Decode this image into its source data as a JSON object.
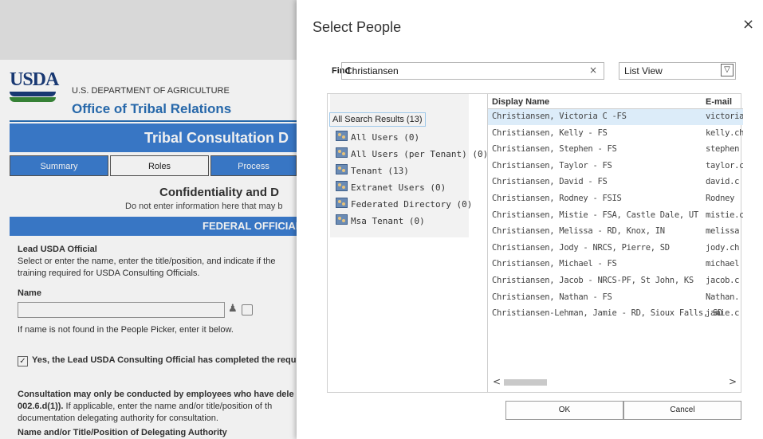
{
  "background": {
    "logo_text": "USDA",
    "department": "U.S. DEPARTMENT OF AGRICULTURE",
    "office": "Office of Tribal Relations",
    "banner": "Tribal Consultation D",
    "tabs": [
      "Summary",
      "Roles",
      "Process"
    ],
    "confidentiality_title": "Confidentiality and D",
    "confidentiality_sub": "Do not enter information here that may b",
    "federal_header": "FEDERAL OFFICIAL(",
    "lead_title": "Lead USDA Official",
    "lead_desc1": "Select or enter the name, enter the title/position, and indicate if the",
    "lead_desc2": "training required for USDA Consulting Officials.",
    "name_label": "Name",
    "not_found": "If name is not found in the People Picker, enter it below.",
    "checkbox_label": "Yes, the Lead USDA Consulting Official has completed the requ",
    "consult_line1": "Consultation may only be conducted by employees who have dele",
    "consult_line2a": "002.6.d(1)).",
    "consult_line2b": " If applicable, enter the name and/or title/position of th",
    "consult_line3": "documentation delegating authority for consultation.",
    "delegating_label": "Name and/or Title/Position of Delegating Authority"
  },
  "dialog": {
    "title": "Select People",
    "close": "×",
    "find_label": "Find",
    "find_value": "Christiansen",
    "find_clear": "×",
    "view_value": "List View",
    "view_arrow": "▽",
    "tree_root": "All Search Results (13)",
    "tree_items": [
      "All Users (0)",
      "All Users (per Tenant) (0)",
      "Tenant (13)",
      "Extranet Users (0)",
      "Federated Directory (0)",
      "Msa Tenant (0)"
    ],
    "columns": {
      "display_name": "Display Name",
      "email": "E-mail"
    },
    "rows": [
      {
        "name": "Christiansen, Victoria C -FS",
        "email": "victoria."
      },
      {
        "name": "Christiansen, Kelly - FS",
        "email": "kelly.ch"
      },
      {
        "name": "Christiansen, Stephen - FS",
        "email": "stephen"
      },
      {
        "name": "Christiansen, Taylor - FS",
        "email": "taylor.c"
      },
      {
        "name": "Christiansen, David - FS",
        "email": "david.c"
      },
      {
        "name": "Christiansen, Rodney - FSIS",
        "email": "Rodney"
      },
      {
        "name": "Christiansen, Mistie - FSA, Castle Dale, UT",
        "email": "mistie.c"
      },
      {
        "name": "Christiansen, Melissa - RD, Knox, IN",
        "email": "melissa"
      },
      {
        "name": "Christiansen, Jody - NRCS, Pierre, SD",
        "email": "jody.ch"
      },
      {
        "name": "Christiansen, Michael - FS",
        "email": "michael"
      },
      {
        "name": "Christiansen, Jacob - NRCS-PF, St John, KS",
        "email": "jacob.c"
      },
      {
        "name": "Christiansen, Nathan - FS",
        "email": "Nathan."
      },
      {
        "name": "Christiansen-Lehman, Jamie - RD, Sioux Falls, SD",
        "email": "jamie.c"
      }
    ],
    "selected_row": 0,
    "scroll_left": "<",
    "scroll_right": ">",
    "ok_label": "OK",
    "cancel_label": "Cancel"
  },
  "colors": {
    "accent_blue": "#3c7ed1",
    "office_blue": "#2a6fb5",
    "selection": "#dcecf9"
  }
}
